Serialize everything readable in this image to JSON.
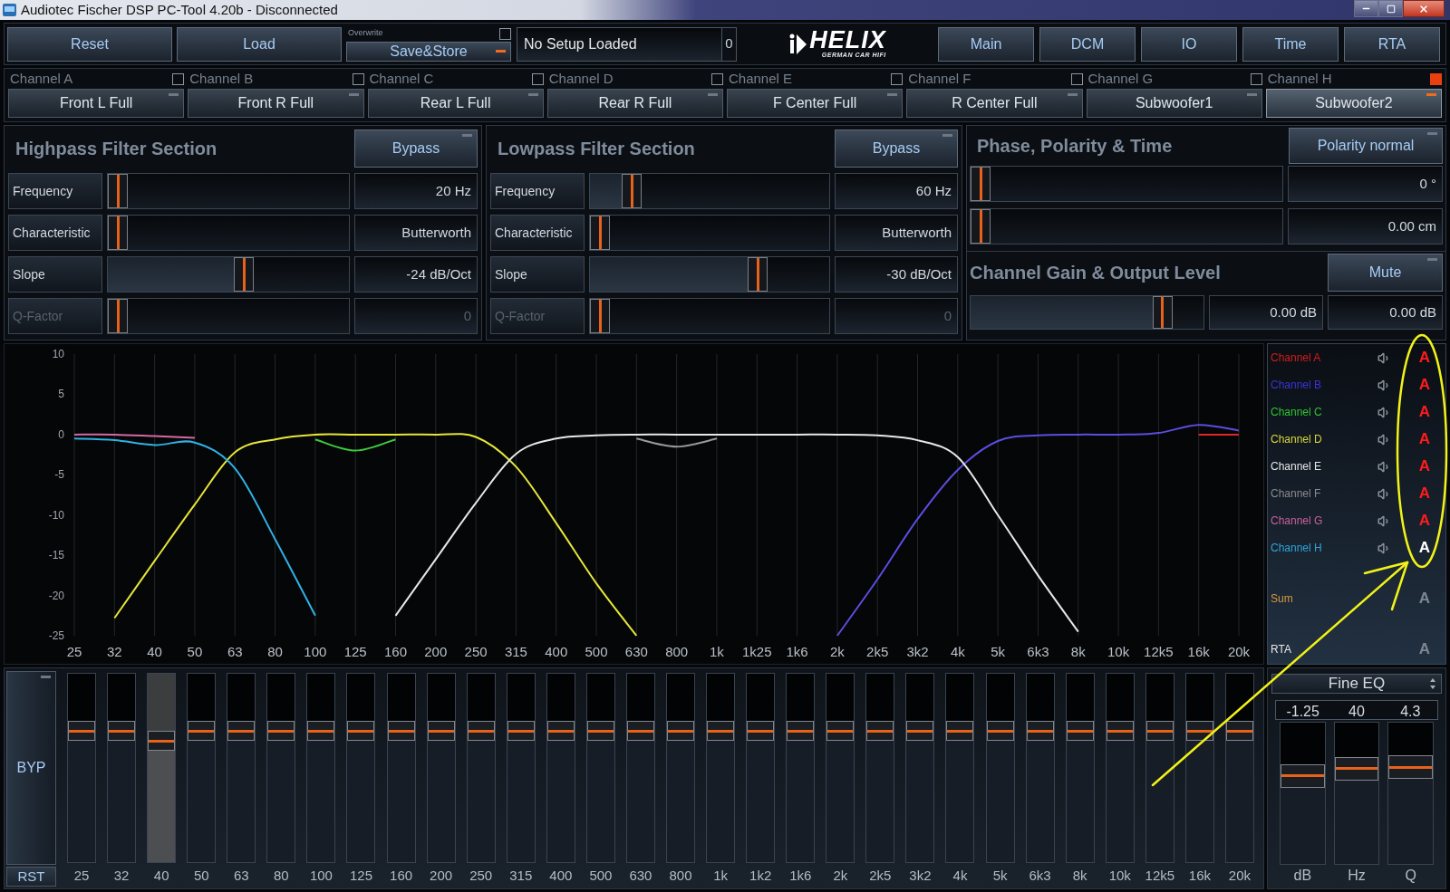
{
  "window": {
    "title": "Audiotec Fischer DSP PC-Tool 4.20b - Disconnected"
  },
  "toolbar": {
    "buttons": [
      {
        "label": "Reset"
      },
      {
        "label": "Load"
      }
    ],
    "save": {
      "overwrite_label": "Overwrite",
      "overwrite_checked": false,
      "label": "Save&Store",
      "on": true
    },
    "setup": {
      "value": "No Setup Loaded",
      "number": "0"
    },
    "logo": {
      "name": "HELIX",
      "tagline": "GERMAN CAR HIFI"
    },
    "nav": [
      {
        "label": "Main"
      },
      {
        "label": "DCM"
      },
      {
        "label": "IO"
      },
      {
        "label": "Time"
      },
      {
        "label": "RTA"
      }
    ]
  },
  "channels": [
    {
      "label": "Channel A",
      "name": "Front L Full",
      "checked": false,
      "selected": false
    },
    {
      "label": "Channel B",
      "name": "Front R Full",
      "checked": false,
      "selected": false
    },
    {
      "label": "Channel C",
      "name": "Rear L Full",
      "checked": false,
      "selected": false
    },
    {
      "label": "Channel D",
      "name": "Rear R Full",
      "checked": false,
      "selected": false
    },
    {
      "label": "Channel E",
      "name": "F Center Full",
      "checked": false,
      "selected": false
    },
    {
      "label": "Channel F",
      "name": "R Center Full",
      "checked": false,
      "selected": false
    },
    {
      "label": "Channel G",
      "name": "Subwoofer1",
      "checked": false,
      "selected": false
    },
    {
      "label": "Channel H",
      "name": "Subwoofer2",
      "checked": true,
      "selected": true
    }
  ],
  "highpass": {
    "title": "Highpass Filter Section",
    "bypass": {
      "label": "Bypass",
      "on": false
    },
    "rows": [
      {
        "label": "Frequency",
        "level": 0,
        "value": "20 Hz",
        "disabled": false
      },
      {
        "label": "Characteristic",
        "level": 0,
        "value": "Butterworth",
        "disabled": false
      },
      {
        "label": "Slope",
        "level": 0.57,
        "value": "-24 dB/Oct",
        "disabled": false
      },
      {
        "label": "Q-Factor",
        "level": 0,
        "value": "0",
        "disabled": true
      }
    ]
  },
  "lowpass": {
    "title": "Lowpass Filter Section",
    "bypass": {
      "label": "Bypass",
      "on": false
    },
    "rows": [
      {
        "label": "Frequency",
        "level": 0.145,
        "value": "60 Hz",
        "disabled": false
      },
      {
        "label": "Characteristic",
        "level": 0,
        "value": "Butterworth",
        "disabled": false
      },
      {
        "label": "Slope",
        "level": 0.72,
        "value": "-30 dB/Oct",
        "disabled": false
      },
      {
        "label": "Q-Factor",
        "level": 0,
        "value": "0",
        "disabled": true
      }
    ]
  },
  "phase": {
    "title": "Phase, Polarity & Time",
    "button": {
      "label": "Polarity normal",
      "on": false
    },
    "rows": [
      {
        "level": 0,
        "value": "0 °"
      },
      {
        "level": 0,
        "value": "0.00 cm"
      }
    ]
  },
  "gain": {
    "title": "Channel Gain & Output Level",
    "button": {
      "label": "Mute",
      "on": false
    },
    "level": 0.855,
    "values": [
      "0.00 dB",
      "0.00 dB"
    ]
  },
  "graph": {
    "chart_data": {
      "type": "line",
      "grid": true,
      "categories": [
        "25",
        "32",
        "40",
        "50",
        "63",
        "80",
        "100",
        "125",
        "160",
        "200",
        "250",
        "315",
        "400",
        "500",
        "630",
        "800",
        "1k",
        "1k25",
        "1k6",
        "2k",
        "2k5",
        "3k2",
        "4k",
        "5k",
        "6k3",
        "8k",
        "10k",
        "12k5",
        "16k",
        "20k"
      ],
      "ylim": [
        -25,
        10
      ],
      "yticks": [
        10,
        5,
        0,
        -5,
        -10,
        -15,
        -20,
        -25
      ],
      "series": [
        {
          "color": "#e02626",
          "values": [
            null,
            null,
            null,
            null,
            null,
            null,
            null,
            null,
            null,
            null,
            null,
            null,
            null,
            null,
            null,
            null,
            null,
            null,
            null,
            null,
            null,
            null,
            null,
            null,
            null,
            null,
            null,
            null,
            0,
            0
          ]
        },
        {
          "color": "#5a4ee0",
          "values": [
            null,
            null,
            null,
            null,
            null,
            null,
            null,
            null,
            null,
            null,
            null,
            null,
            null,
            null,
            null,
            null,
            null,
            null,
            null,
            -25,
            -18,
            -10.5,
            -4.4,
            -0.8,
            -0.1,
            0,
            0,
            0.2,
            1.2,
            0.5
          ]
        },
        {
          "color": "#3ccc3c",
          "values": [
            null,
            null,
            null,
            null,
            null,
            null,
            -0.6,
            -2,
            -0.6,
            null,
            null,
            null,
            null,
            null,
            null,
            null,
            null,
            null,
            null,
            null,
            null,
            null,
            null,
            null,
            null,
            null,
            null,
            null,
            null,
            null
          ]
        },
        {
          "color": "#e6e63a",
          "values": [
            null,
            -22.8,
            -15.7,
            -8.7,
            -2.2,
            -0.6,
            0,
            0,
            0,
            0,
            -0.3,
            -4,
            -11,
            -18.5,
            -25,
            null,
            null,
            null,
            null,
            null,
            null,
            null,
            null,
            null,
            null,
            null,
            null,
            null,
            null,
            null
          ]
        },
        {
          "color": "#9a9a9a",
          "values": [
            null,
            null,
            null,
            null,
            null,
            null,
            null,
            null,
            null,
            null,
            null,
            null,
            null,
            null,
            -0.5,
            -1.5,
            -0.5,
            null,
            null,
            null,
            null,
            null,
            null,
            null,
            null,
            null,
            null,
            null,
            null,
            null
          ]
        },
        {
          "color": "#e8e8e8",
          "values": [
            null,
            null,
            null,
            null,
            null,
            null,
            null,
            null,
            -22.5,
            -15.5,
            -8.5,
            -2.4,
            -0.5,
            -0.1,
            0,
            0,
            0,
            0,
            0,
            0,
            -0.1,
            -0.7,
            -2.8,
            -10,
            -17.5,
            -24.5,
            null,
            null,
            null,
            null
          ]
        },
        {
          "color": "#d46aa4",
          "values": [
            0,
            0,
            -0.2,
            -0.4,
            null,
            null,
            null,
            null,
            null,
            null,
            null,
            null,
            null,
            null,
            null,
            null,
            null,
            null,
            null,
            null,
            null,
            null,
            null,
            null,
            null,
            null,
            null,
            null,
            null,
            null
          ]
        },
        {
          "color": "#2fb2e6",
          "values": [
            -0.5,
            -0.7,
            -1.3,
            -1,
            -4.2,
            -13,
            -22.5,
            null,
            null,
            null,
            null,
            null,
            null,
            null,
            null,
            null,
            null,
            null,
            null,
            null,
            null,
            null,
            null,
            null,
            null,
            null,
            null,
            null,
            null,
            null
          ]
        }
      ]
    }
  },
  "legend": [
    {
      "kind": "channel",
      "label": "Channel A",
      "color": "#d41c1c",
      "marker": "A",
      "on": true,
      "selected": false
    },
    {
      "kind": "channel",
      "label": "Channel B",
      "color": "#3a34d6",
      "marker": "A",
      "on": true,
      "selected": false
    },
    {
      "kind": "channel",
      "label": "Channel C",
      "color": "#2ec42e",
      "marker": "A",
      "on": true,
      "selected": false
    },
    {
      "kind": "channel",
      "label": "Channel D",
      "color": "#d6d63a",
      "marker": "A",
      "on": true,
      "selected": false
    },
    {
      "kind": "channel",
      "label": "Channel E",
      "color": "#e6e6e6",
      "marker": "A",
      "on": true,
      "selected": false
    },
    {
      "kind": "channel",
      "label": "Channel F",
      "color": "#8c8c8c",
      "marker": "A",
      "on": true,
      "selected": false
    },
    {
      "kind": "channel",
      "label": "Channel G",
      "color": "#c9609a",
      "marker": "A",
      "on": true,
      "selected": false
    },
    {
      "kind": "channel",
      "label": "Channel H",
      "color": "#2ea6d8",
      "marker": "A",
      "on": true,
      "selected": true
    },
    {
      "kind": "total",
      "label": "Sum",
      "color": "#d29a3c",
      "marker": "A",
      "on": false,
      "selected": false
    },
    {
      "kind": "total",
      "label": "RTA",
      "color": "#e6e6e6",
      "marker": "A",
      "on": false,
      "selected": false
    }
  ],
  "eq": {
    "bypass": {
      "label": "BYP",
      "on": false
    },
    "reset": "RST",
    "bands": [
      {
        "label": "25",
        "level": 0.72,
        "selected": false
      },
      {
        "label": "32",
        "level": 0.72,
        "selected": false
      },
      {
        "label": "40",
        "level": 0.66,
        "selected": true
      },
      {
        "label": "50",
        "level": 0.72,
        "selected": false
      },
      {
        "label": "63",
        "level": 0.72,
        "selected": false
      },
      {
        "label": "80",
        "level": 0.72,
        "selected": false
      },
      {
        "label": "100",
        "level": 0.72,
        "selected": false
      },
      {
        "label": "125",
        "level": 0.72,
        "selected": false
      },
      {
        "label": "160",
        "level": 0.72,
        "selected": false
      },
      {
        "label": "200",
        "level": 0.72,
        "selected": false
      },
      {
        "label": "250",
        "level": 0.72,
        "selected": false
      },
      {
        "label": "315",
        "level": 0.72,
        "selected": false
      },
      {
        "label": "400",
        "level": 0.72,
        "selected": false
      },
      {
        "label": "500",
        "level": 0.72,
        "selected": false
      },
      {
        "label": "630",
        "level": 0.72,
        "selected": false
      },
      {
        "label": "800",
        "level": 0.72,
        "selected": false
      },
      {
        "label": "1k",
        "level": 0.72,
        "selected": false
      },
      {
        "label": "1k2",
        "level": 0.72,
        "selected": false
      },
      {
        "label": "1k6",
        "level": 0.72,
        "selected": false
      },
      {
        "label": "2k",
        "level": 0.72,
        "selected": false
      },
      {
        "label": "2k5",
        "level": 0.72,
        "selected": false
      },
      {
        "label": "3k2",
        "level": 0.72,
        "selected": false
      },
      {
        "label": "4k",
        "level": 0.72,
        "selected": false
      },
      {
        "label": "5k",
        "level": 0.72,
        "selected": false
      },
      {
        "label": "6k3",
        "level": 0.72,
        "selected": false
      },
      {
        "label": "8k",
        "level": 0.72,
        "selected": false
      },
      {
        "label": "10k",
        "level": 0.72,
        "selected": false
      },
      {
        "label": "12k5",
        "level": 0.72,
        "selected": false
      },
      {
        "label": "16k",
        "level": 0.72,
        "selected": false
      },
      {
        "label": "20k",
        "level": 0.72,
        "selected": false
      }
    ]
  },
  "fine_eq": {
    "mode": "Fine EQ",
    "params": [
      {
        "value": "-1.25",
        "unit": "dB",
        "level": 0.65
      },
      {
        "value": "40",
        "unit": "Hz",
        "level": 0.71
      },
      {
        "value": "4.3",
        "unit": "Q",
        "level": 0.72
      }
    ]
  }
}
